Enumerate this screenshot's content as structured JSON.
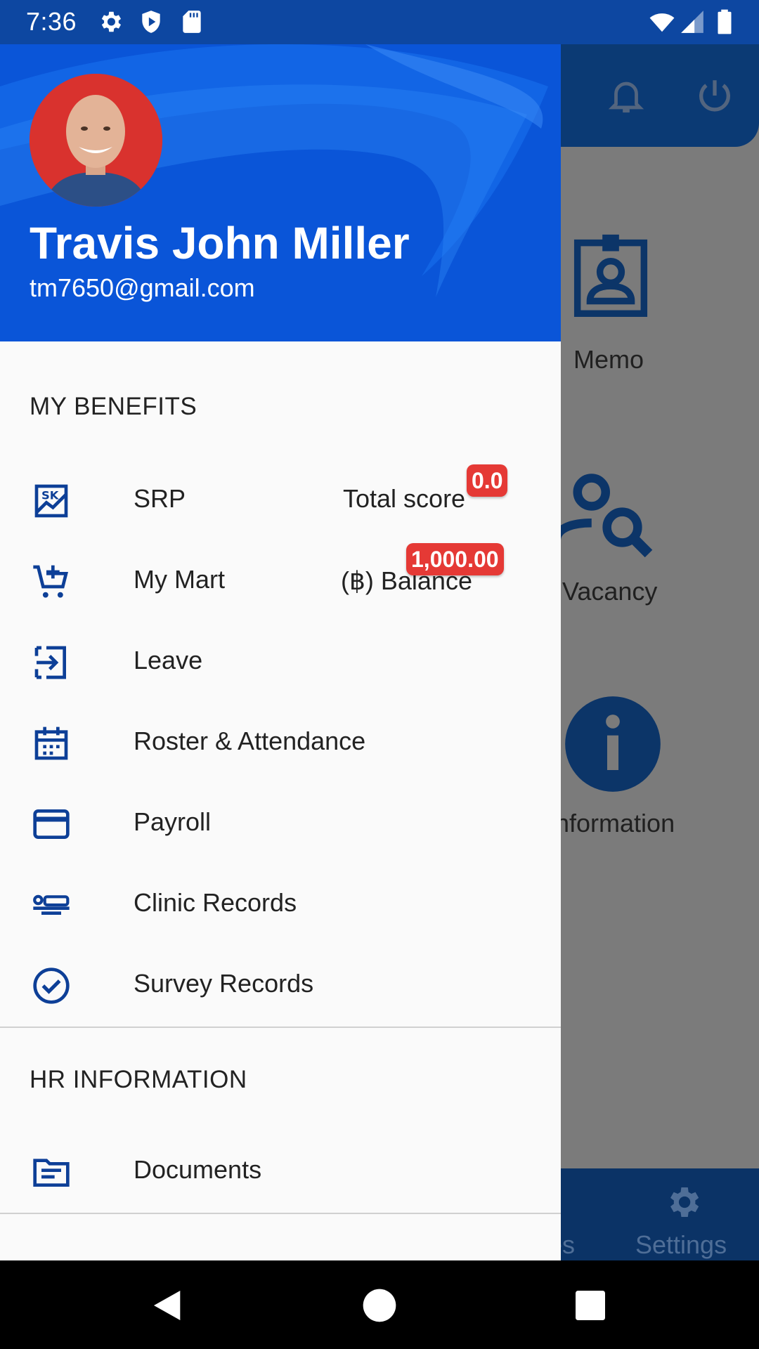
{
  "status_bar": {
    "time": "7:36",
    "left_icons": [
      "gear-icon",
      "shield-play-icon",
      "sd-card-icon"
    ],
    "right_icons": [
      "wifi-icon",
      "signal-icon",
      "battery-icon"
    ]
  },
  "background_app": {
    "top_icons": [
      "bell-icon",
      "power-icon"
    ],
    "tiles": [
      {
        "label": "Memo",
        "icon": "badge-icon"
      },
      {
        "label": "Vacancy",
        "icon": "person-search-icon"
      },
      {
        "label": "nformation",
        "icon": "info-icon"
      }
    ],
    "bottom_nav": [
      {
        "label": "es"
      },
      {
        "label": "Settings",
        "icon": "gear-icon"
      }
    ]
  },
  "drawer": {
    "header": {
      "name": "Travis John Miller",
      "email": "tm7650@gmail.com",
      "brand_color": "#0a55d8"
    },
    "sections": [
      {
        "title": "MY BENEFITS",
        "items": [
          {
            "label": "SRP",
            "icon": "srp-icon",
            "extra": "Total score",
            "badge": "0.0"
          },
          {
            "label": "My Mart",
            "icon": "add-cart-icon",
            "extra": "(฿) Balance",
            "badge": "1,000.00"
          },
          {
            "label": "Leave",
            "icon": "leave-icon"
          },
          {
            "label": "Roster & Attendance",
            "icon": "calendar-icon"
          },
          {
            "label": "Payroll",
            "icon": "credit-card-icon"
          },
          {
            "label": "Clinic Records",
            "icon": "bed-icon"
          },
          {
            "label": "Survey Records",
            "icon": "check-circle-icon"
          }
        ]
      },
      {
        "title": "HR INFORMATION",
        "items": [
          {
            "label": "Documents",
            "icon": "document-icon"
          }
        ]
      }
    ],
    "badge_color": "#e53935"
  },
  "nav_bar": {
    "buttons": [
      "back-icon",
      "home-icon",
      "recents-icon"
    ]
  }
}
